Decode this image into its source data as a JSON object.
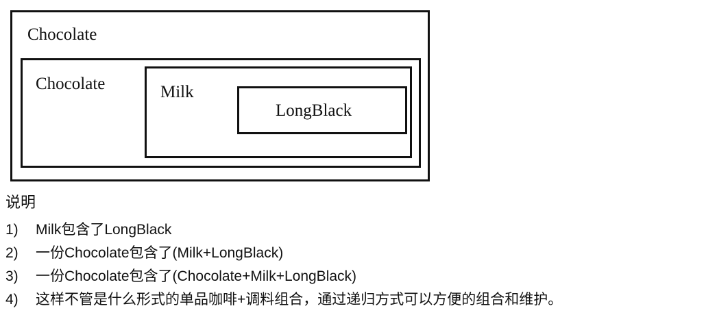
{
  "diagram": {
    "outer": {
      "label": "Chocolate"
    },
    "second": {
      "label": "Chocolate"
    },
    "third": {
      "label": "Milk"
    },
    "inner": {
      "label": "LongBlack"
    }
  },
  "notes": {
    "title": "说明",
    "items": [
      {
        "num": "1)",
        "text": "Milk包含了LongBlack"
      },
      {
        "num": "2)",
        "text": "一份Chocolate包含了(Milk+LongBlack)"
      },
      {
        "num": "3)",
        "text": "一份Chocolate包含了(Chocolate+Milk+LongBlack)"
      },
      {
        "num": "4)",
        "text": "这样不管是什么形式的单品咖啡+调料组合，通过递归方式可以方便的组合和维护。"
      }
    ]
  }
}
